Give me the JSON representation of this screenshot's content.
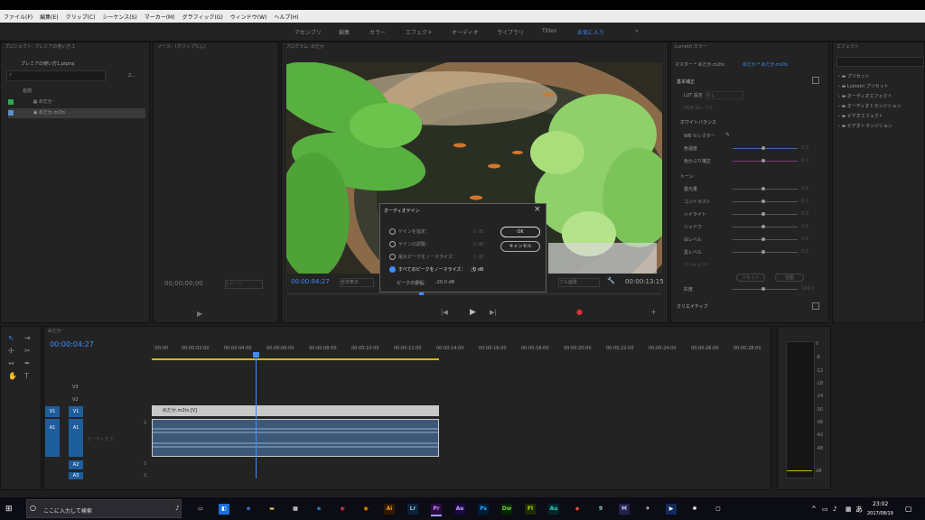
{
  "menu": [
    "ファイル(F)",
    "編集(E)",
    "クリップ(C)",
    "シーケンス(S)",
    "マーカー(M)",
    "グラフィック(G)",
    "ウィンドウ(W)",
    "ヘルプ(H)"
  ],
  "workspace_tabs": [
    "アセンブリ",
    "編集",
    "カラー",
    "エフェクト",
    "オーディオ",
    "ライブラリ",
    "Titles",
    "お気に入り"
  ],
  "project": {
    "panel_label": "プロジェクト: プレミアの使い方 1",
    "file": "プレミアの使い方1.prproj",
    "count": "2...",
    "col_name": "名前",
    "items": [
      {
        "label": "めだか"
      },
      {
        "label": "めだか.m2ts"
      }
    ]
  },
  "source": {
    "panel_label": "ソース：(クリップなし)",
    "timecode": "00;00;00;00",
    "page": "1ページ"
  },
  "program": {
    "panel_label": "プログラム: めだか",
    "timecode": "00:00:04:27",
    "fit": "全体表示",
    "quality": "フル画質",
    "duration": "00:00:13:15"
  },
  "lumetri": {
    "panel_label": "Lumetri カラー",
    "master": "マスター * めだか.m2ts",
    "clip": "めだか * めだか.m2ts",
    "basic": "基本補正",
    "lut_label": "LUT 設定",
    "lut_value": "なし",
    "hdr": "HDR 白レベル",
    "wb_section": "ホワイトバランス",
    "wb_selector": "WB セレクター",
    "temp": "色温度",
    "tint": "色かぶり補正",
    "tone": "トーン",
    "exposure": "露光量",
    "contrast": "コントラスト",
    "highlight": "ハイライト",
    "shadow": "シャドウ",
    "white": "白レベル",
    "black": "黒レベル",
    "specular": "スペキュラー",
    "reset": "リセット",
    "auto": "自動",
    "saturation": "彩度",
    "saturation_value": "100.0",
    "zero": "0.0",
    "creative": "クリエイティブ"
  },
  "effects": {
    "panel_label": "エフェクト",
    "items": [
      "プリセット",
      "Lumetri プリセット",
      "オーディオエフェクト",
      "オーディオトランジション",
      "ビデオエフェクト",
      "ビデオトランジション"
    ]
  },
  "dialog": {
    "title": "オーディオゲイン",
    "options": [
      "ゲインを指定：",
      "ゲインの調整：",
      "最大ピークをノーマライズ：",
      "すべてのピークをノーマライズ："
    ],
    "values": [
      "0 dB",
      "0 dB",
      "0 dB",
      "0 dB"
    ],
    "peak_label": "ピークの振幅：",
    "peak_value": "-20.0 dB",
    "ok": "OK",
    "cancel": "キャンセル",
    "selected_index": 3
  },
  "timeline": {
    "tab": "めだか",
    "timecode": "00:00:04:27",
    "ruler": [
      ":00:00",
      "00:00:02:00",
      "00:00:04:00",
      "00:00:06:00",
      "00:00:08:00",
      "00:00:10:00",
      "00:00:12:00",
      "00:00:14:00",
      "00:00:16:00",
      "00:00:18:00",
      "00:00:20:00",
      "00:00:22:00",
      "00:00:24:00",
      "00:00:26:00",
      "00:00:28:00",
      "00:00:30"
    ],
    "tracks_video": [
      "V3",
      "V2",
      "V1"
    ],
    "tracks_audio": [
      "A1",
      "A2",
      "A3"
    ],
    "src_v": "V1",
    "src_a": "A1",
    "video_clip": "めだか.m2ts [V]",
    "audio_name": "オーディオ 1",
    "s_label": "S"
  },
  "meter": {
    "scale": [
      "0",
      "-6",
      "-12",
      "-18",
      "-24",
      "-30",
      "-36",
      "-42",
      "-48",
      "dB"
    ]
  },
  "taskbar": {
    "search": "ここに入力して検索",
    "time": "23:02",
    "date": "2017/08/19",
    "ime": "あ"
  },
  "colors": {
    "accent": "#3f8cff",
    "track_blue": "#1f5e9c",
    "clip_green": "#32a852",
    "clip_blue": "#5a8fcc"
  }
}
